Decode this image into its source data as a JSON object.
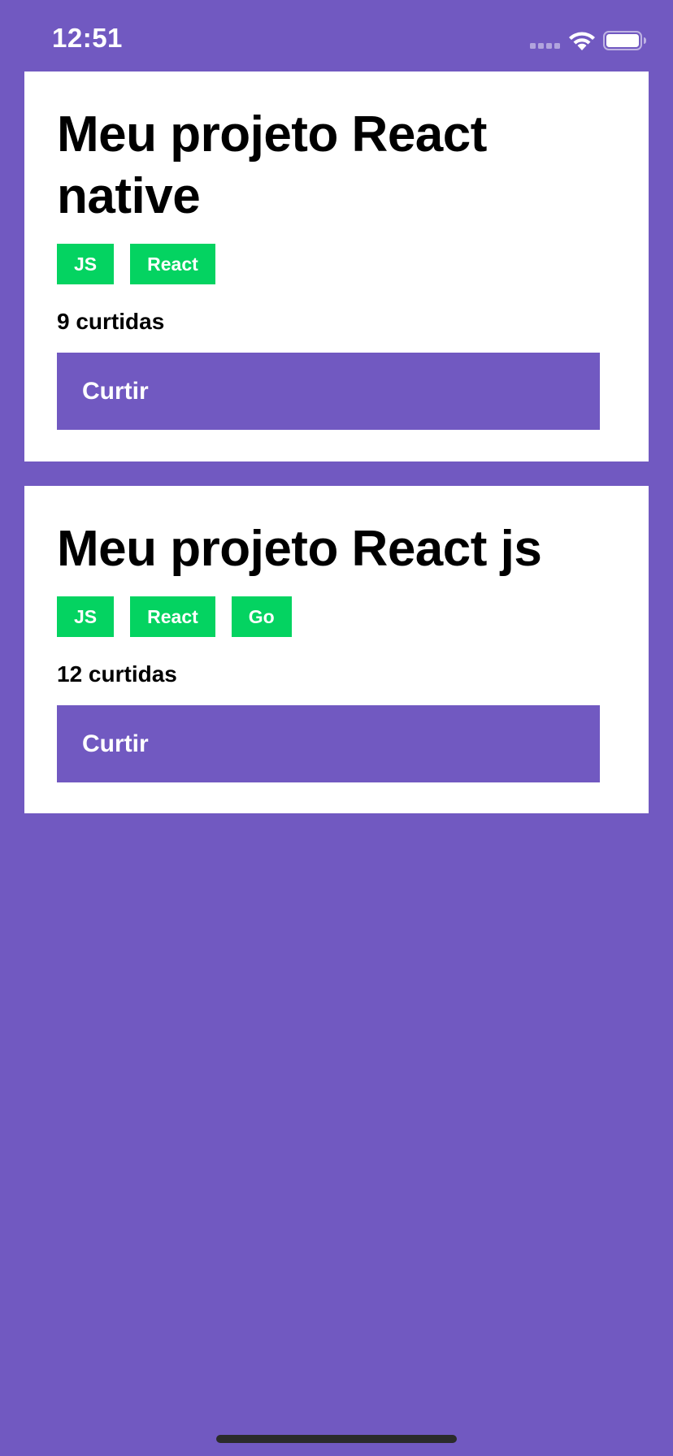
{
  "status_bar": {
    "time": "12:51",
    "icons": [
      "signal-icon",
      "wifi-icon",
      "battery-icon"
    ]
  },
  "colors": {
    "background": "#7159c1",
    "card": "#ffffff",
    "tech_badge": "#04d361",
    "button": "#7159c1",
    "text": "#000000",
    "home_indicator": "#2b2b2b"
  },
  "projects": [
    {
      "title": "Meu projeto React native",
      "techs": [
        "JS",
        "React"
      ],
      "likes_text": "9 curtidas",
      "like_button_label": "Curtir"
    },
    {
      "title": "Meu projeto React js",
      "techs": [
        "JS",
        "React",
        "Go"
      ],
      "likes_text": "12 curtidas",
      "like_button_label": "Curtir"
    }
  ]
}
